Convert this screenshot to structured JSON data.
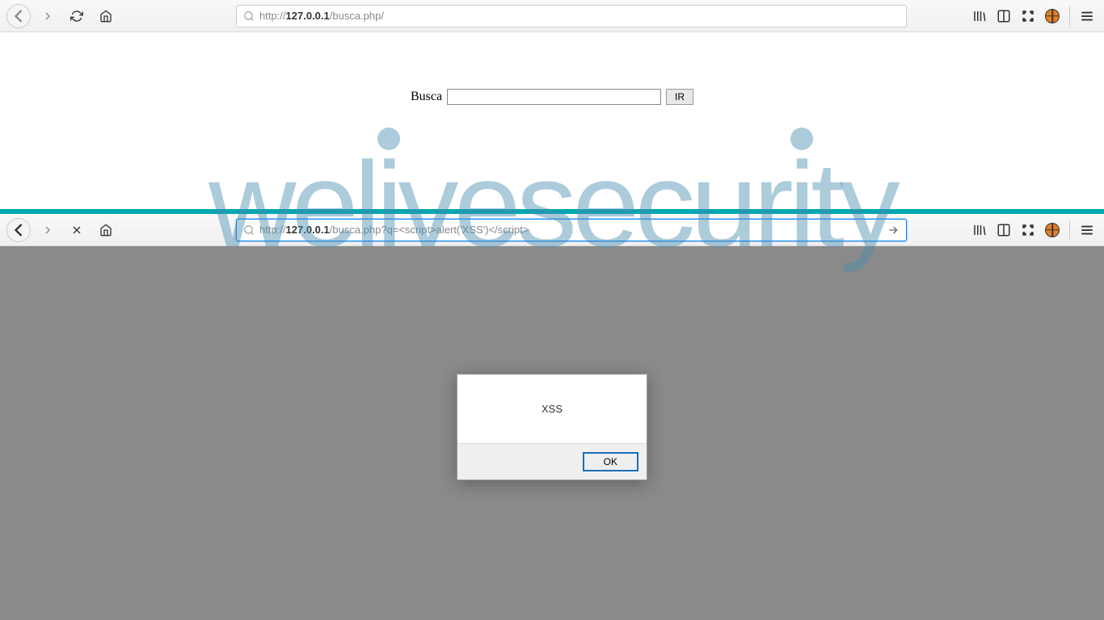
{
  "browser1": {
    "url_prefix": "http://",
    "url_bold": "127.0.0.1",
    "url_suffix": "/busca.php/"
  },
  "browser2": {
    "url_prefix": "http://",
    "url_bold": "127.0.0.1",
    "url_suffix": "/busca.php?q=<script>alert('XSS')</script>"
  },
  "page1": {
    "search_label": "Busca",
    "search_value": "",
    "button_label": "IR"
  },
  "alert": {
    "message": "XSS",
    "ok_label": "OK"
  },
  "watermark": "welivesecurity"
}
